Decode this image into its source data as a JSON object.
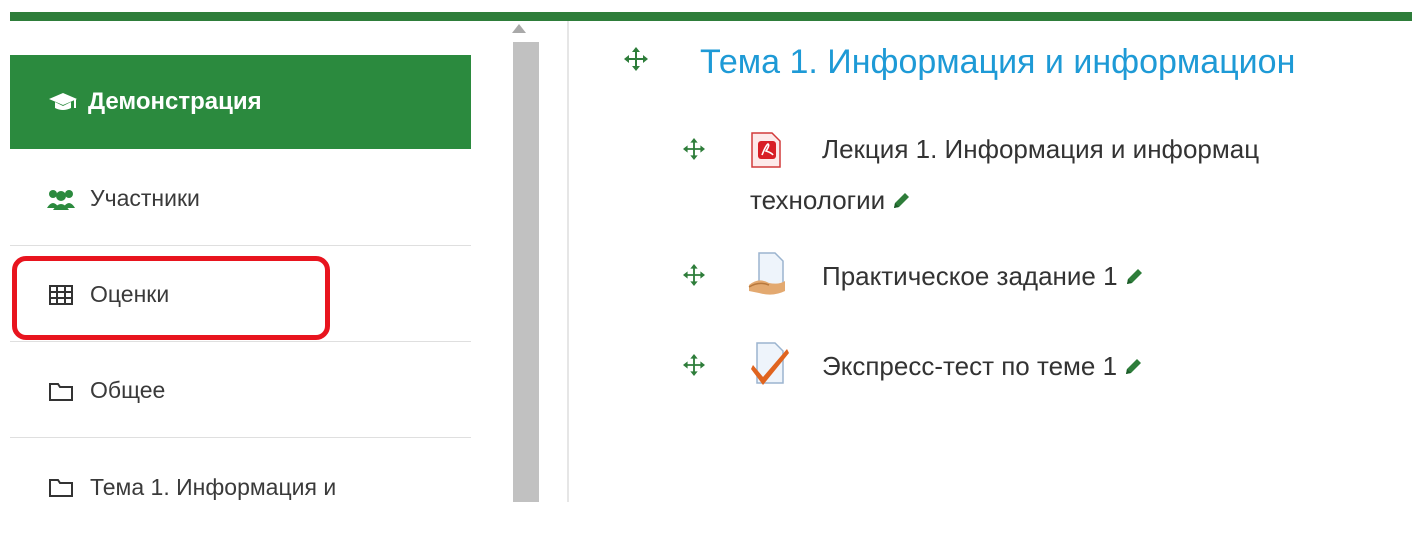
{
  "colors": {
    "brand_green": "#2b8a3e",
    "link_blue": "#1e9ad6",
    "highlight_red": "#e8141e"
  },
  "sidebar": {
    "items": [
      {
        "label": "Демонстрация",
        "icon": "graduation-cap-icon",
        "active": true
      },
      {
        "label": "Участники",
        "icon": "users-icon"
      },
      {
        "label": "Оценки",
        "icon": "table-icon",
        "highlighted": true
      },
      {
        "label": "Общее",
        "icon": "folder-icon"
      },
      {
        "label": "Тема 1. Информация и",
        "icon": "folder-icon"
      }
    ]
  },
  "main": {
    "section_title": "Тема 1. Информация и информацион",
    "activities": [
      {
        "line1": "Лекция 1. Информация и информац",
        "line2": "технологии",
        "icon": "pdf-icon"
      },
      {
        "line1": "Практическое задание 1",
        "icon": "assignment-icon"
      },
      {
        "line1": "Экспресс-тест по теме 1",
        "icon": "quiz-icon"
      }
    ]
  }
}
